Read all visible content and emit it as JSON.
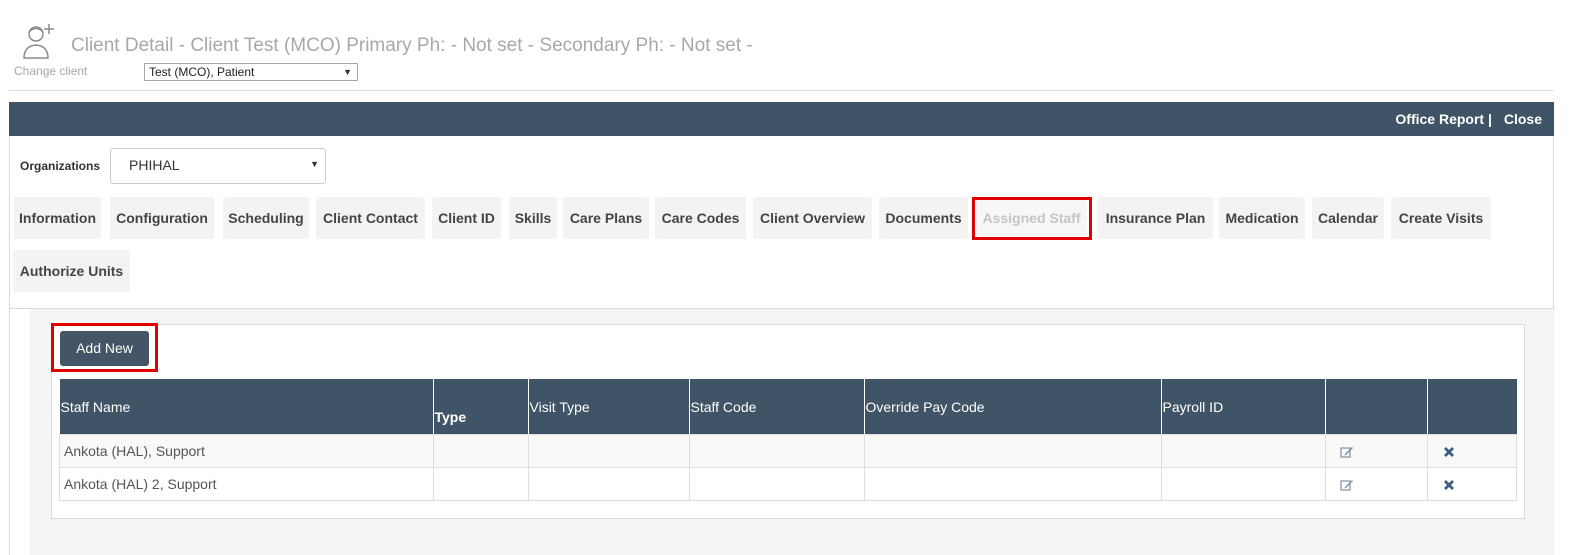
{
  "header": {
    "title": "Client Detail - Client Test (MCO) Primary Ph: - Not set - Secondary Ph: - Not set -",
    "change_client_label": "Change client",
    "client_select_value": "Test (MCO), Patient",
    "icon": "user-add-icon"
  },
  "topbar": {
    "office_report": "Office Report |",
    "close": "Close"
  },
  "organization": {
    "label": "Organizations",
    "selected": "PHIHAL"
  },
  "tabs": [
    {
      "label": "Information"
    },
    {
      "label": "Configuration"
    },
    {
      "label": "Scheduling"
    },
    {
      "label": "Client Contact"
    },
    {
      "label": "Client ID"
    },
    {
      "label": "Skills"
    },
    {
      "label": "Care Plans"
    },
    {
      "label": "Care Codes"
    },
    {
      "label": "Client Overview"
    },
    {
      "label": "Documents"
    },
    {
      "label": "Assigned Staff",
      "active": true
    },
    {
      "label": "Insurance Plan"
    },
    {
      "label": "Medication"
    },
    {
      "label": "Calendar"
    },
    {
      "label": "Create Visits"
    },
    {
      "label": "Authorize Units"
    }
  ],
  "assigned_staff": {
    "add_button": "Add New",
    "columns": [
      "Staff Name",
      "Type",
      "Visit Type",
      "Staff Code",
      "Override Pay Code",
      "Payroll ID",
      "",
      ""
    ],
    "rows": [
      {
        "staff_name": "Ankota (HAL), Support",
        "type": "",
        "visit_type": "",
        "staff_code": "",
        "override_pay_code": "",
        "payroll_id": "",
        "edit_icon": "edit-icon",
        "delete_icon": "delete-icon"
      },
      {
        "staff_name": "Ankota (HAL) 2, Support",
        "type": "",
        "visit_type": "",
        "staff_code": "",
        "override_pay_code": "",
        "payroll_id": "",
        "edit_icon": "edit-icon",
        "delete_icon": "delete-icon"
      }
    ]
  },
  "colors": {
    "header_bar": "#3f5466",
    "button": "#435567",
    "highlight": "#e00000"
  }
}
